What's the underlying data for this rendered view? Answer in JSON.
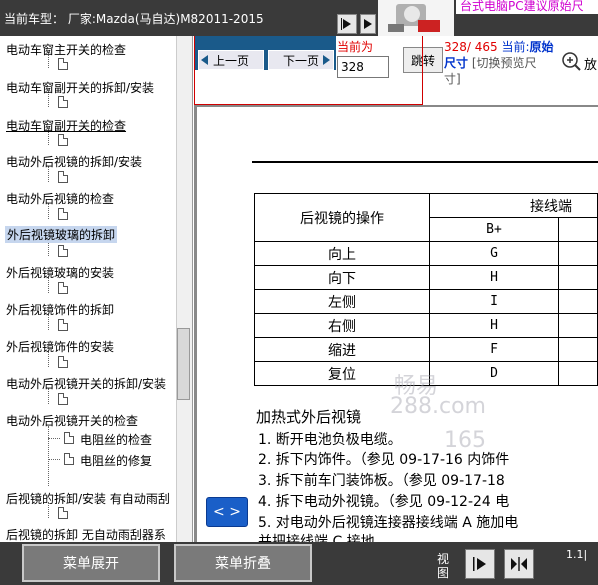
{
  "header": {
    "vehicle_title": "当前车型：  厂家:Mazda(马自达)M82011-2015",
    "ad_text": "台式电脑PC建议原始尺"
  },
  "sidebar": {
    "items": [
      {
        "label": "电动车窗主开关的检查"
      },
      {
        "label": "电动车窗副开关的拆卸/安装"
      },
      {
        "label": "电动车窗副开关的检查"
      },
      {
        "label": "电动外后视镜的拆卸/安装"
      },
      {
        "label": "电动外后视镜的检查"
      },
      {
        "label": "外后视镜玻璃的拆卸"
      },
      {
        "label": "外后视镜玻璃的安装"
      },
      {
        "label": "外后视镜饰件的拆卸"
      },
      {
        "label": "外后视镜饰件的安装"
      },
      {
        "label": "电动外后视镜开关的拆卸/安装"
      },
      {
        "label": "电动外后视镜开关的检查"
      },
      {
        "label": "电阻丝的检查"
      },
      {
        "label": "电阻丝的修复"
      },
      {
        "label": "后视镜的拆卸/安装 有自动雨刮"
      },
      {
        "label": "后视镜的拆卸 无自动雨刮器系"
      }
    ]
  },
  "pager": {
    "prev_label": "上一页",
    "next_label": "下一页",
    "current_label": "当前为",
    "page_value": "328",
    "jump_label": "跳转",
    "page_count": "328/ 465",
    "current_word": "当前:",
    "original_word": "原始",
    "size_word": "尺寸",
    "toggle_hint": "[切换预览尺",
    "toggle_hint2": "寸]",
    "zoom_label": "放"
  },
  "document": {
    "table": {
      "head_op": "后视镜的操作",
      "head_term": "接线端",
      "head_bplus": "B+",
      "rows": [
        {
          "op": "向上",
          "v": "G"
        },
        {
          "op": "向下",
          "v": "H"
        },
        {
          "op": "左侧",
          "v": "I"
        },
        {
          "op": "右侧",
          "v": "H"
        },
        {
          "op": "缩进",
          "v": "F"
        },
        {
          "op": "复位",
          "v": "D"
        }
      ]
    },
    "section_title": "加热式外后视镜",
    "steps": [
      "1.  断开电池负极电缆。",
      "2.  拆下内饰件。（参见 09-17-16 内饰件",
      "3.  拆下前车门装饰板。（参见 09-17-18",
      "4.  拆下电动外视镜。（参见 09-12-24 电",
      "5.  对电动外后视镜连接器接线端 A 施加电",
      "    并把接线端 C 接地。"
    ],
    "watermark": [
      "畅易",
      "288.com",
      "165"
    ]
  },
  "nav_button": {
    "label": "< >"
  },
  "bottom": {
    "expand_label": "菜单展开",
    "collapse_label": "菜单折叠",
    "view_label": "视图",
    "version": "1.1|"
  }
}
